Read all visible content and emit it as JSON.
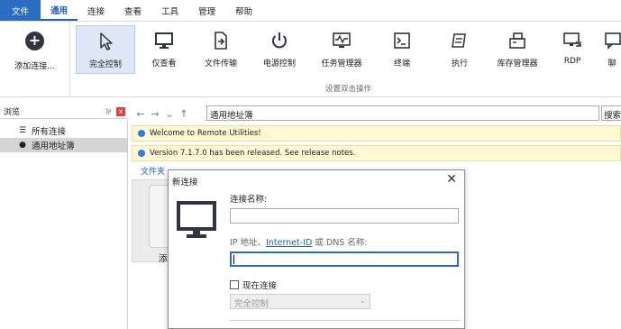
{
  "menubar": {
    "items": [
      "文件",
      "通用",
      "连接",
      "查看",
      "工具",
      "管理",
      "帮助"
    ]
  },
  "ribbon": {
    "add_label": "添加连接...",
    "buttons": [
      {
        "label": "完全控制",
        "icon": "cursor-icon"
      },
      {
        "label": "仅查看",
        "icon": "monitor-icon"
      },
      {
        "label": "文件传输",
        "icon": "file-transfer-icon"
      },
      {
        "label": "电源控制",
        "icon": "power-icon"
      },
      {
        "label": "任务管理器",
        "icon": "task-manager-icon"
      },
      {
        "label": "终端",
        "icon": "terminal-icon"
      },
      {
        "label": "执行",
        "icon": "execute-icon"
      },
      {
        "label": "库存管理器",
        "icon": "inventory-icon"
      },
      {
        "label": "RDP",
        "icon": "rdp-icon"
      },
      {
        "label": "聊",
        "icon": "chat-icon"
      }
    ],
    "group_label": "设置双击操作"
  },
  "left_panel": {
    "title": "浏览",
    "pin": "⅌",
    "close": "x",
    "items": [
      "所有连接",
      "通用地址簿"
    ]
  },
  "address_bar": {
    "path": "通用地址簿",
    "search_placeholder": "搜索"
  },
  "notices": [
    "Welcome to Remote Utilities!",
    "Version 7.1.7.0 has been released. See release notes."
  ],
  "files": {
    "tab_label": "文件夹",
    "card_label": "添"
  },
  "dialog": {
    "title": "新连接",
    "close": "✕",
    "name_label": "连接名称:",
    "name_value": "",
    "addr_label_prefix": "IP 地址、",
    "addr_label_link": "Internet-ID",
    "addr_label_suffix": " 或 DNS 名称:",
    "addr_value": "",
    "connect_now_label": "现在连接",
    "mode_value": "完全控制"
  },
  "colors": {
    "accent": "#2b6cc4",
    "notice_bg": "#fff8d2",
    "selected_ribbon": "#dde7f6"
  }
}
